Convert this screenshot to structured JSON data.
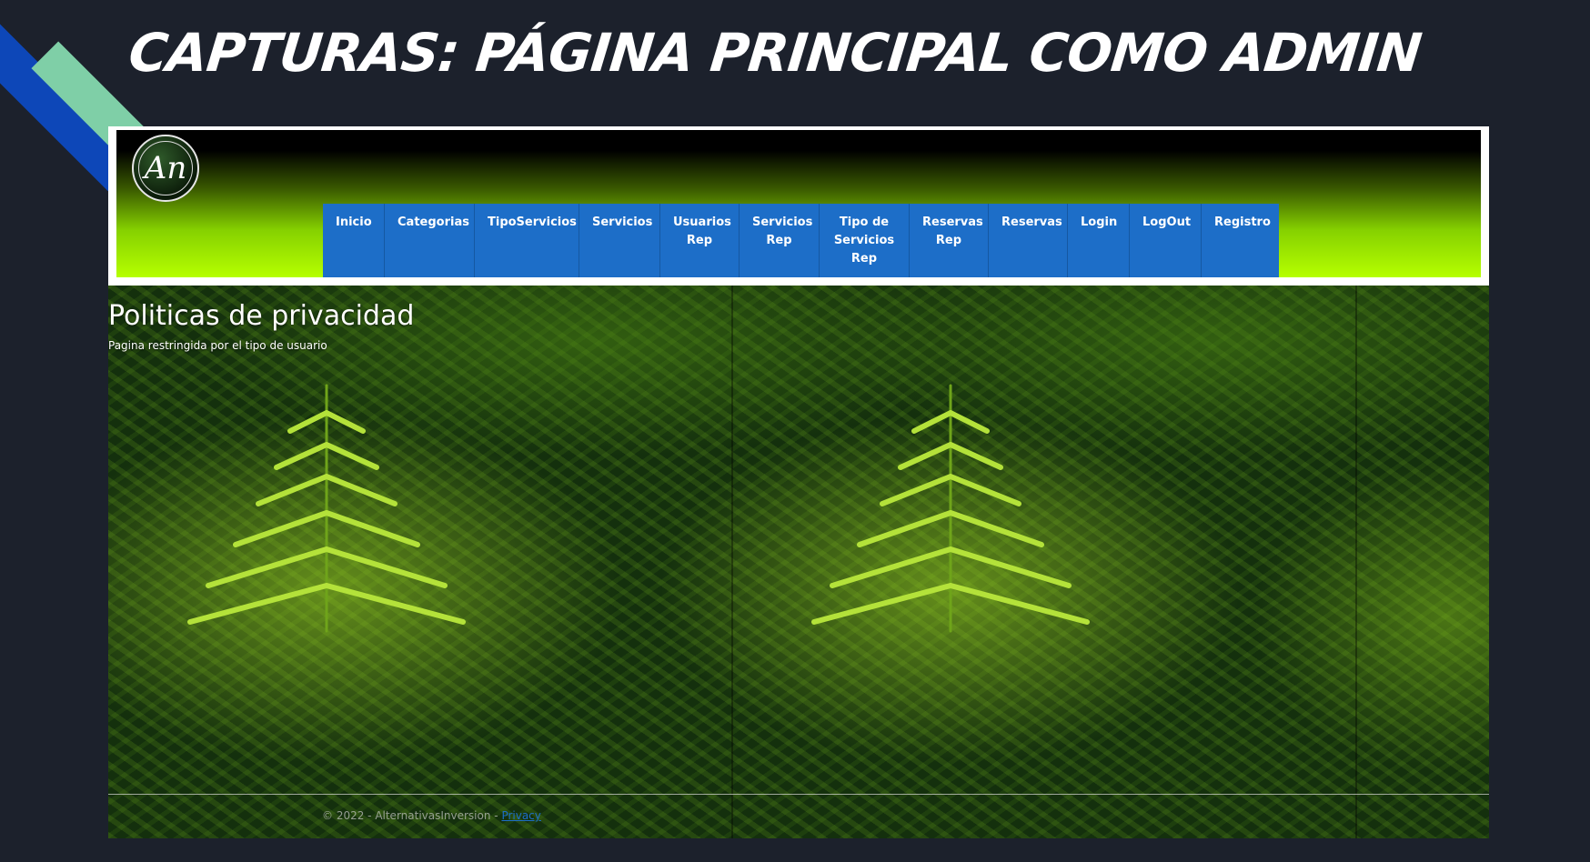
{
  "slide": {
    "title": "CAPTURAS: PÁGINA PRINCIPAL COMO ADMIN"
  },
  "site": {
    "logo_text": "An",
    "nav": [
      {
        "label": "Inicio"
      },
      {
        "label": "Categorias"
      },
      {
        "label": "TipoServicios"
      },
      {
        "label": "Servicios"
      },
      {
        "label": "Usuarios Rep"
      },
      {
        "label": "Servicios Rep"
      },
      {
        "label": "Tipo de Servicios Rep"
      },
      {
        "label": "Reservas Rep"
      },
      {
        "label": "Reservas"
      },
      {
        "label": "Login"
      },
      {
        "label": "LogOut"
      },
      {
        "label": "Registro"
      }
    ],
    "page_title": "Politicas de privacidad",
    "page_subtitle": "Pagina restringida por el tipo de usuario",
    "footer": {
      "copyright": "© 2022 - AlternativasInversion - ",
      "privacy_link": "Privacy"
    }
  },
  "colors": {
    "slide_background": "#1c212c",
    "nav_button": "#1d6ec8",
    "header_gradient_top": "#000000",
    "header_gradient_bottom": "#b6ff00",
    "deco_blue": "#0d47b8",
    "deco_green": "#7fcfa7"
  }
}
